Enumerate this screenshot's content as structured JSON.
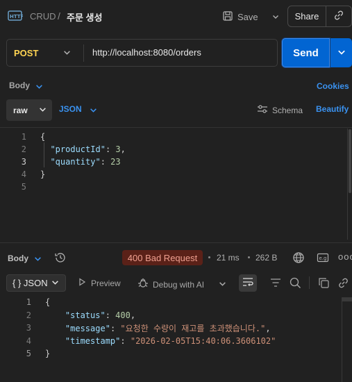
{
  "header": {
    "app_name": "CRUD",
    "separator": "/",
    "request_title": "주문 생성",
    "save_label": "Save",
    "share_label": "Share"
  },
  "request": {
    "method": "POST",
    "url": "http://localhost:8080/orders",
    "send_label": "Send"
  },
  "request_tabs": {
    "body_label": "Body",
    "cookies_label": "Cookies",
    "body_type": "raw",
    "format": "JSON",
    "schema_label": "Schema",
    "beautify_label": "Beautify"
  },
  "request_body": {
    "lines": [
      {
        "num": "1",
        "text": "{"
      },
      {
        "num": "2",
        "text": "  \"productId\": 3,"
      },
      {
        "num": "3",
        "text": "  \"quantity\": 23"
      },
      {
        "num": "4",
        "text": "}"
      },
      {
        "num": "5",
        "text": ""
      }
    ]
  },
  "response_bar": {
    "body_label": "Body",
    "status": "400 Bad Request",
    "status_color": "#5a2118",
    "time": "21 ms",
    "size": "262 B",
    "more": "ooo"
  },
  "response_tabs": {
    "format_label": "{ } JSON",
    "preview_label": "Preview",
    "debug_label": "Debug with AI"
  },
  "response_body": {
    "lines": [
      {
        "num": "1",
        "text": "{"
      },
      {
        "num": "2",
        "text": "    \"status\": 400,"
      },
      {
        "num": "3",
        "text": "    \"message\": \"요청한 수량이 재고를 초과했습니다.\","
      },
      {
        "num": "4",
        "text": "    \"timestamp\": \"2026-02-05T15:40:06.3606102\""
      },
      {
        "num": "5",
        "text": "}"
      }
    ]
  },
  "icons": {
    "app_logo": "http-logo-icon",
    "save": "save-icon",
    "link": "link-icon",
    "history": "history-icon",
    "globe": "globe-icon",
    "save_response": "save-response-icon",
    "preview": "play-icon",
    "debug": "debug-ai-icon",
    "wrap": "wrap-lines-icon",
    "filter": "filter-icon",
    "search": "search-icon",
    "copy": "copy-icon"
  }
}
